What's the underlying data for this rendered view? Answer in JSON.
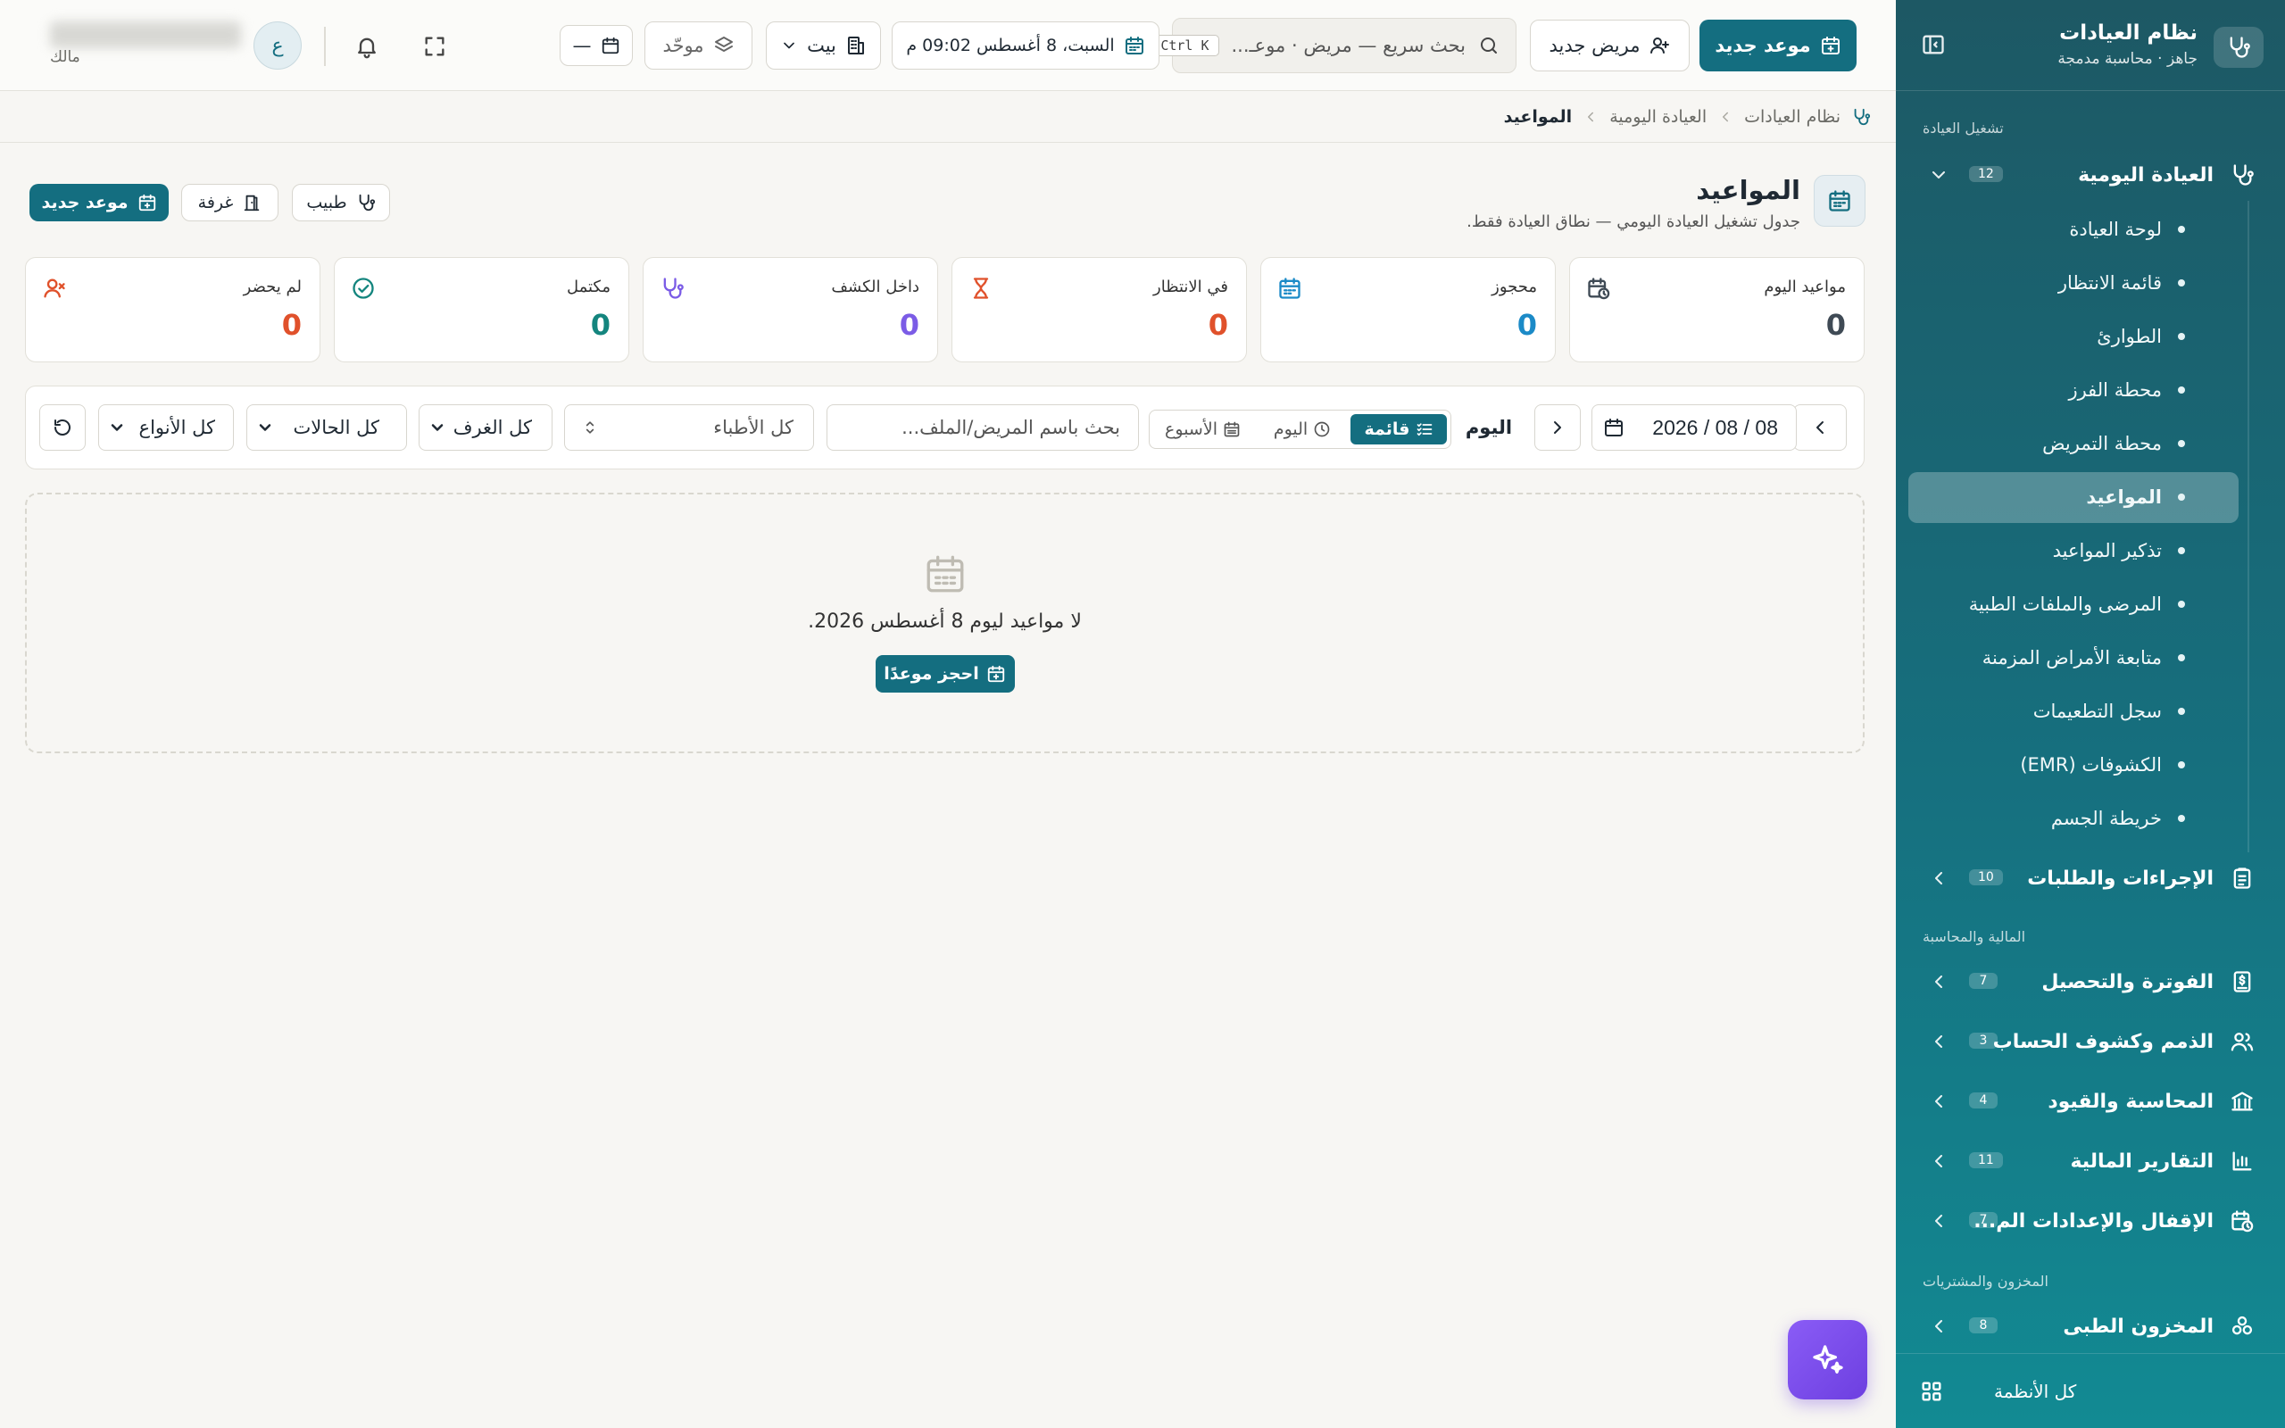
{
  "sidebar": {
    "title": "نظام العيادات",
    "subtitle": "جاهز · محاسبة مدمجة",
    "sections": {
      "clinic_ops": "تشغيل العيادة",
      "finance": "المالية والمحاسبة",
      "inventory": "المخزون والمشتريات"
    },
    "groups": [
      {
        "label": "العيادة اليومية",
        "badge": "12",
        "icon": "stethoscope-icon",
        "expanded": true
      },
      {
        "label": "الإجراءات والطلبات",
        "badge": "10",
        "icon": "clipboard-icon"
      },
      {
        "label": "الفوترة والتحصيل",
        "badge": "7",
        "icon": "invoice-dollar-icon"
      },
      {
        "label": "الذمم وكشوف الحساب",
        "badge": "3",
        "icon": "users-icon"
      },
      {
        "label": "المحاسبة والقيود",
        "badge": "4",
        "icon": "bank-icon"
      },
      {
        "label": "التقارير المالية",
        "badge": "11",
        "icon": "bar-chart-icon"
      },
      {
        "label": "الإقفال والإعدادات الم...",
        "badge": "7",
        "icon": "calendar-clock-icon"
      },
      {
        "label": "المخزون الطبى",
        "badge": "8",
        "icon": "boxes-icon"
      }
    ],
    "daily_items": [
      "لوحة العيادة",
      "قائمة الانتظار",
      "الطوارئ",
      "محطة الفرز",
      "محطة التمريض",
      "المواعيد",
      "تذكير المواعيد",
      "المرضى والملفات الطبية",
      "متابعة الأمراض المزمنة",
      "سجل التطعيمات",
      "الكشوفات (EMR)",
      "خريطة الجسم"
    ],
    "active_item": "المواعيد",
    "footer": "كل الأنظمة"
  },
  "topbar": {
    "new_appointment": "موعد جديد",
    "new_patient": "مريض جديد",
    "search_placeholder": "بحث سريع — مريض · موعـ...",
    "search_shortcut": "Ctrl K",
    "datetime": "السبت، 8 أغسطس  09:02 م",
    "branch": "بيت",
    "mode": "موحّد",
    "date_filter": "—",
    "avatar_initial": "ع",
    "user_role": "مالك"
  },
  "breadcrumb": [
    "نظام العيادات",
    "العيادة اليومية",
    "المواعيد"
  ],
  "page": {
    "title": "المواعيد",
    "subtitle": "جدول تشغيل العيادة اليومي — نطاق العيادة فقط.",
    "actions": {
      "new_appointment": "موعد جديد",
      "room": "غرفة",
      "doctor": "طبيب"
    }
  },
  "stats": [
    {
      "label": "مواعيد اليوم",
      "value": "0",
      "color": "#3f4a55",
      "icon": "calendar-clock-icon"
    },
    {
      "label": "محجوز",
      "value": "0",
      "color": "#1b8ac7",
      "icon": "calendar-icon"
    },
    {
      "label": "في الانتظار",
      "value": "0",
      "color": "#e0512b",
      "icon": "hourglass-icon"
    },
    {
      "label": "داخل الكشف",
      "value": "0",
      "color": "#7b5ce6",
      "icon": "stethoscope-icon"
    },
    {
      "label": "مكتمل",
      "value": "0",
      "color": "#14857e",
      "icon": "check-circle-icon"
    },
    {
      "label": "لم يحضر",
      "value": "0",
      "color": "#e0512b",
      "icon": "user-x-icon"
    }
  ],
  "filters": {
    "date": "08 / 08 / 2026",
    "today": "اليوم",
    "views": [
      "قائمة",
      "اليوم",
      "الأسبوع"
    ],
    "active_view": "قائمة",
    "patient_search_placeholder": "بحث باسم المريض/الملف...",
    "doctor": "كل الأطباء",
    "rooms": "كل الغرف",
    "statuses": "كل الحالات",
    "types": "كل الأنواع"
  },
  "empty": {
    "message": "لا مواعيد ليوم 8 أغسطس 2026.",
    "button": "احجز موعدًا"
  }
}
